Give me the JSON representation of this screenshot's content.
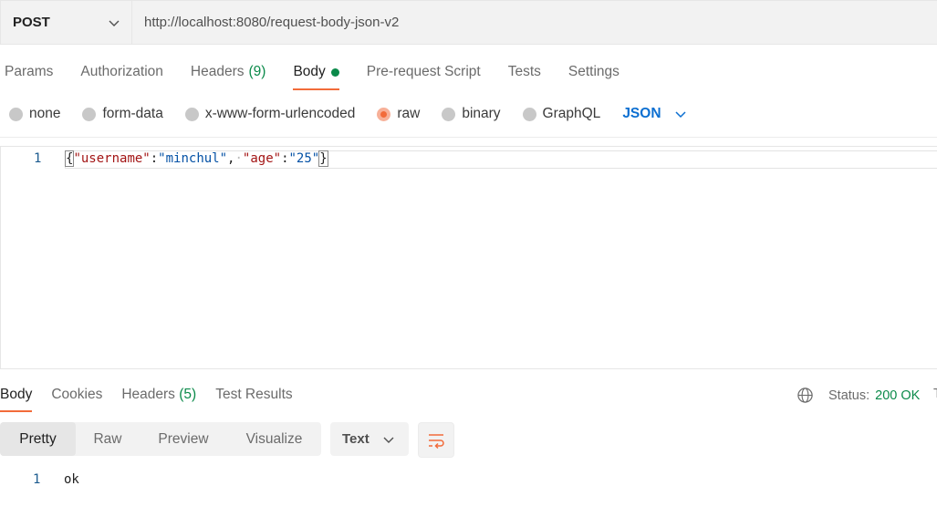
{
  "request": {
    "method": "POST",
    "url": "http://localhost:8080/request-body-json-v2"
  },
  "request_tabs": [
    {
      "label": "Params"
    },
    {
      "label": "Authorization"
    },
    {
      "label": "Headers",
      "count": "(9)"
    },
    {
      "label": "Body"
    },
    {
      "label": "Pre-request Script"
    },
    {
      "label": "Tests"
    },
    {
      "label": "Settings"
    }
  ],
  "body_types": {
    "options": [
      "none",
      "form-data",
      "x-www-form-urlencoded",
      "raw",
      "binary",
      "GraphQL"
    ],
    "selected": "raw",
    "language": "JSON"
  },
  "editor": {
    "line_number": "1",
    "tokens": {
      "open": "{",
      "key1": "\"username\"",
      "colon1": ":",
      "val1": "\"minchul\"",
      "comma": ",",
      "space_dot": "·",
      "key2": "\"age\"",
      "colon2": ":",
      "val2": "\"25\"",
      "close": "}"
    }
  },
  "response_tabs": [
    {
      "label": "Body"
    },
    {
      "label": "Cookies"
    },
    {
      "label": "Headers",
      "count": "(5)"
    },
    {
      "label": "Test Results"
    }
  ],
  "status": {
    "label": "Status:",
    "value": "200 OK",
    "cut": "T"
  },
  "response_view": {
    "modes": [
      "Pretty",
      "Raw",
      "Preview",
      "Visualize"
    ],
    "active_mode": "Pretty",
    "format": "Text"
  },
  "response_body": {
    "line_number": "1",
    "text": "ok"
  },
  "colors": {
    "accent": "#f26b3a",
    "success": "#0b8a4a",
    "link": "#0c6fd1"
  }
}
